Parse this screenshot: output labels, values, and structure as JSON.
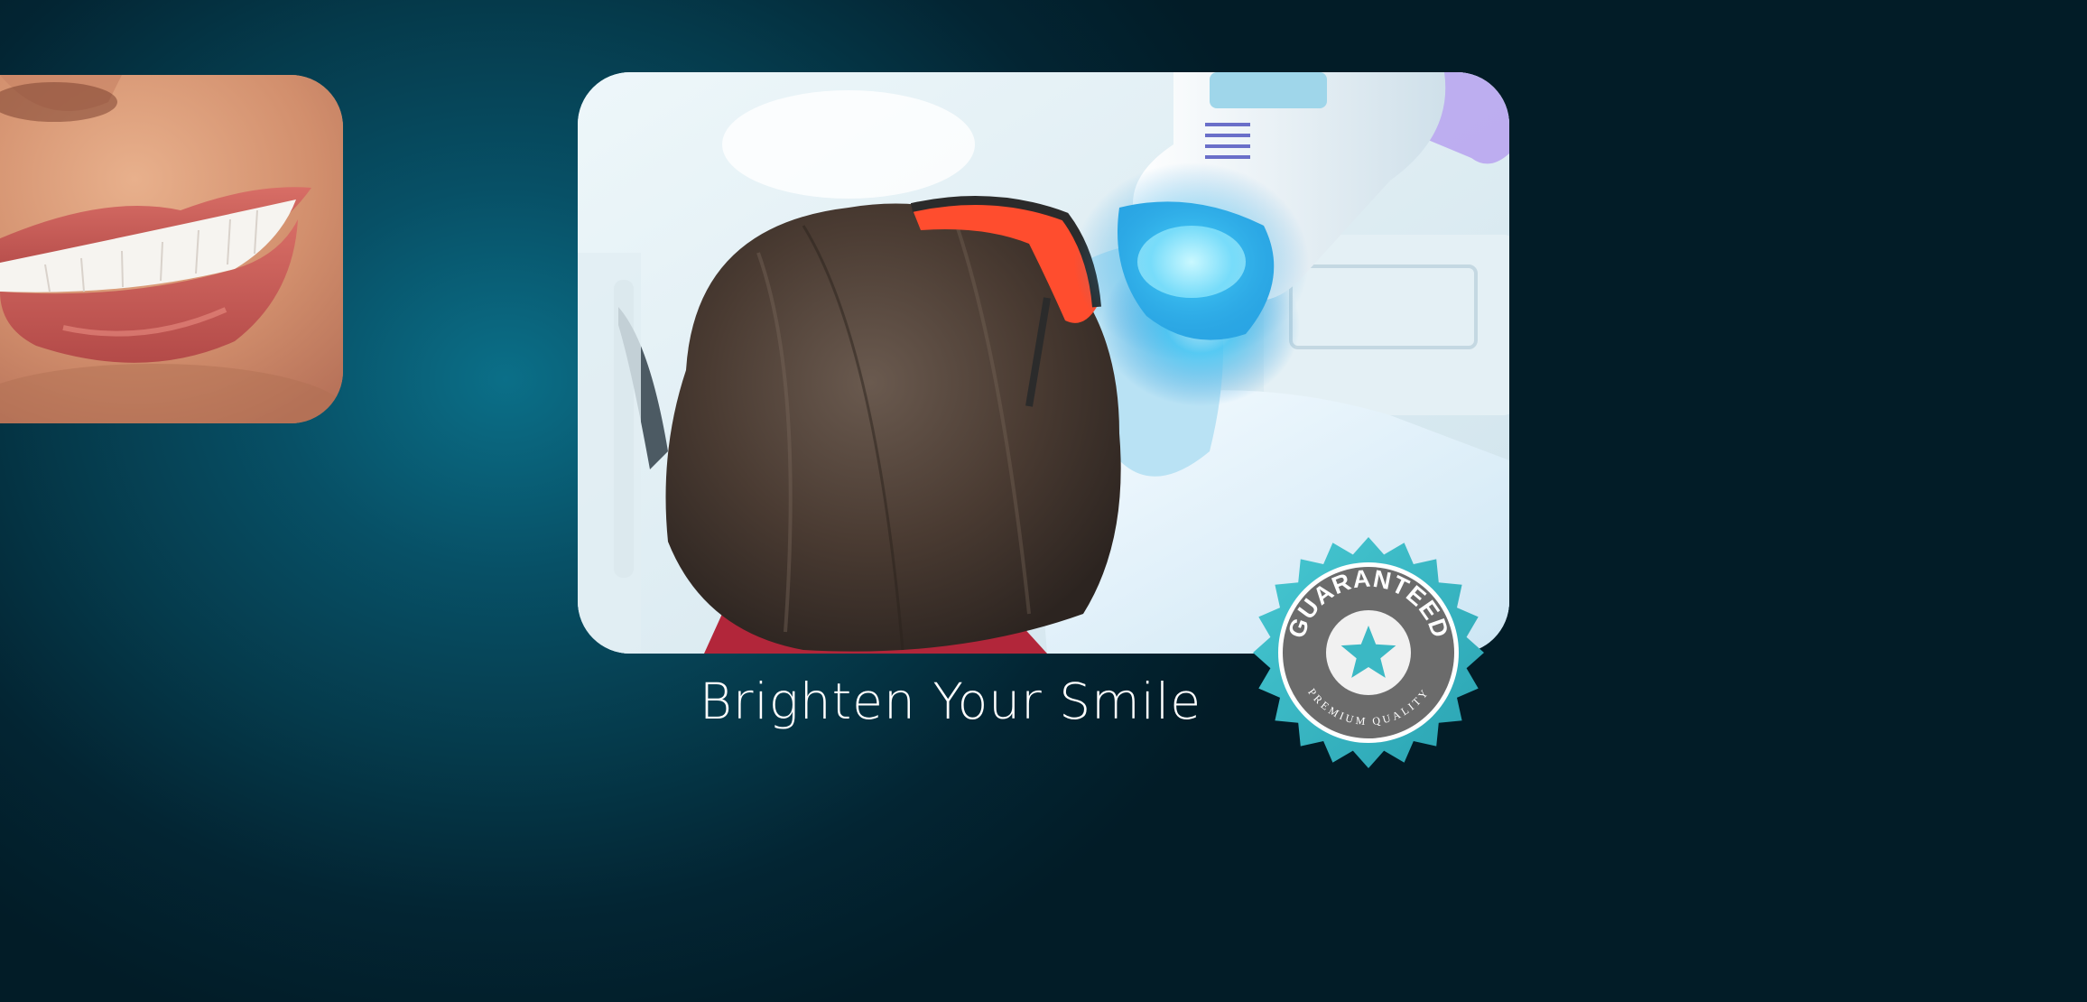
{
  "hero": {
    "headline": "Brighten Your Smile"
  },
  "badge": {
    "top_text": "GUARANTEED",
    "bottom_text": "PREMIUM QUALITY",
    "icon": "star-icon",
    "accent_color": "#3db8c4",
    "ring_color": "#6b6b6b"
  },
  "images": {
    "smile": "smile-closeup-photo",
    "treatment": "teeth-whitening-treatment-photo"
  },
  "colors": {
    "background": "#03222f",
    "headline": "#ffffff"
  }
}
